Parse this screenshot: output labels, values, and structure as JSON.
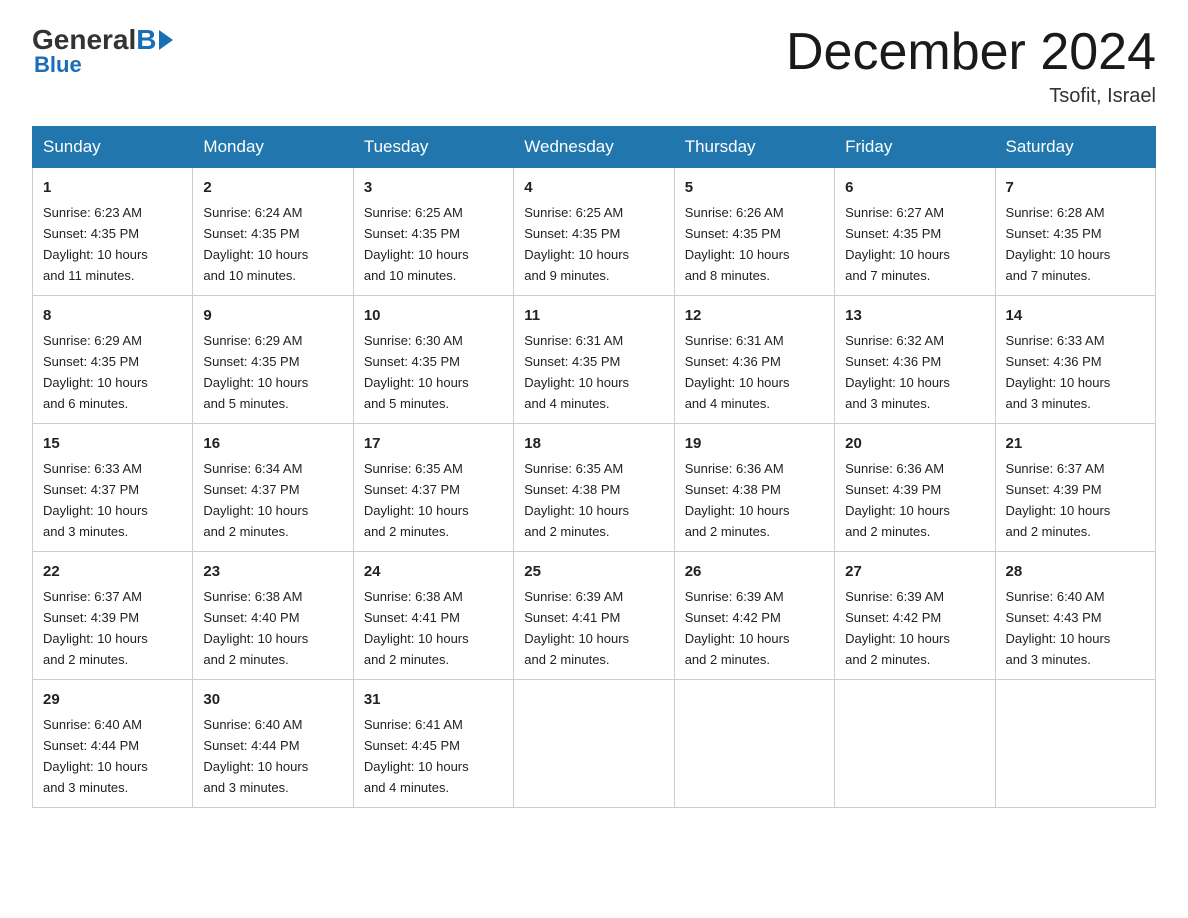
{
  "logo": {
    "general": "General",
    "blue": "Blue",
    "tagline": "Blue"
  },
  "header": {
    "title": "December 2024",
    "subtitle": "Tsofit, Israel"
  },
  "days_of_week": [
    "Sunday",
    "Monday",
    "Tuesday",
    "Wednesday",
    "Thursday",
    "Friday",
    "Saturday"
  ],
  "weeks": [
    [
      {
        "day": "1",
        "sunrise": "6:23 AM",
        "sunset": "4:35 PM",
        "daylight": "10 hours and 11 minutes."
      },
      {
        "day": "2",
        "sunrise": "6:24 AM",
        "sunset": "4:35 PM",
        "daylight": "10 hours and 10 minutes."
      },
      {
        "day": "3",
        "sunrise": "6:25 AM",
        "sunset": "4:35 PM",
        "daylight": "10 hours and 10 minutes."
      },
      {
        "day": "4",
        "sunrise": "6:25 AM",
        "sunset": "4:35 PM",
        "daylight": "10 hours and 9 minutes."
      },
      {
        "day": "5",
        "sunrise": "6:26 AM",
        "sunset": "4:35 PM",
        "daylight": "10 hours and 8 minutes."
      },
      {
        "day": "6",
        "sunrise": "6:27 AM",
        "sunset": "4:35 PM",
        "daylight": "10 hours and 7 minutes."
      },
      {
        "day": "7",
        "sunrise": "6:28 AM",
        "sunset": "4:35 PM",
        "daylight": "10 hours and 7 minutes."
      }
    ],
    [
      {
        "day": "8",
        "sunrise": "6:29 AM",
        "sunset": "4:35 PM",
        "daylight": "10 hours and 6 minutes."
      },
      {
        "day": "9",
        "sunrise": "6:29 AM",
        "sunset": "4:35 PM",
        "daylight": "10 hours and 5 minutes."
      },
      {
        "day": "10",
        "sunrise": "6:30 AM",
        "sunset": "4:35 PM",
        "daylight": "10 hours and 5 minutes."
      },
      {
        "day": "11",
        "sunrise": "6:31 AM",
        "sunset": "4:35 PM",
        "daylight": "10 hours and 4 minutes."
      },
      {
        "day": "12",
        "sunrise": "6:31 AM",
        "sunset": "4:36 PM",
        "daylight": "10 hours and 4 minutes."
      },
      {
        "day": "13",
        "sunrise": "6:32 AM",
        "sunset": "4:36 PM",
        "daylight": "10 hours and 3 minutes."
      },
      {
        "day": "14",
        "sunrise": "6:33 AM",
        "sunset": "4:36 PM",
        "daylight": "10 hours and 3 minutes."
      }
    ],
    [
      {
        "day": "15",
        "sunrise": "6:33 AM",
        "sunset": "4:37 PM",
        "daylight": "10 hours and 3 minutes."
      },
      {
        "day": "16",
        "sunrise": "6:34 AM",
        "sunset": "4:37 PM",
        "daylight": "10 hours and 2 minutes."
      },
      {
        "day": "17",
        "sunrise": "6:35 AM",
        "sunset": "4:37 PM",
        "daylight": "10 hours and 2 minutes."
      },
      {
        "day": "18",
        "sunrise": "6:35 AM",
        "sunset": "4:38 PM",
        "daylight": "10 hours and 2 minutes."
      },
      {
        "day": "19",
        "sunrise": "6:36 AM",
        "sunset": "4:38 PM",
        "daylight": "10 hours and 2 minutes."
      },
      {
        "day": "20",
        "sunrise": "6:36 AM",
        "sunset": "4:39 PM",
        "daylight": "10 hours and 2 minutes."
      },
      {
        "day": "21",
        "sunrise": "6:37 AM",
        "sunset": "4:39 PM",
        "daylight": "10 hours and 2 minutes."
      }
    ],
    [
      {
        "day": "22",
        "sunrise": "6:37 AM",
        "sunset": "4:39 PM",
        "daylight": "10 hours and 2 minutes."
      },
      {
        "day": "23",
        "sunrise": "6:38 AM",
        "sunset": "4:40 PM",
        "daylight": "10 hours and 2 minutes."
      },
      {
        "day": "24",
        "sunrise": "6:38 AM",
        "sunset": "4:41 PM",
        "daylight": "10 hours and 2 minutes."
      },
      {
        "day": "25",
        "sunrise": "6:39 AM",
        "sunset": "4:41 PM",
        "daylight": "10 hours and 2 minutes."
      },
      {
        "day": "26",
        "sunrise": "6:39 AM",
        "sunset": "4:42 PM",
        "daylight": "10 hours and 2 minutes."
      },
      {
        "day": "27",
        "sunrise": "6:39 AM",
        "sunset": "4:42 PM",
        "daylight": "10 hours and 2 minutes."
      },
      {
        "day": "28",
        "sunrise": "6:40 AM",
        "sunset": "4:43 PM",
        "daylight": "10 hours and 3 minutes."
      }
    ],
    [
      {
        "day": "29",
        "sunrise": "6:40 AM",
        "sunset": "4:44 PM",
        "daylight": "10 hours and 3 minutes."
      },
      {
        "day": "30",
        "sunrise": "6:40 AM",
        "sunset": "4:44 PM",
        "daylight": "10 hours and 3 minutes."
      },
      {
        "day": "31",
        "sunrise": "6:41 AM",
        "sunset": "4:45 PM",
        "daylight": "10 hours and 4 minutes."
      },
      null,
      null,
      null,
      null
    ]
  ],
  "labels": {
    "sunrise": "Sunrise:",
    "sunset": "Sunset:",
    "daylight": "Daylight:"
  }
}
